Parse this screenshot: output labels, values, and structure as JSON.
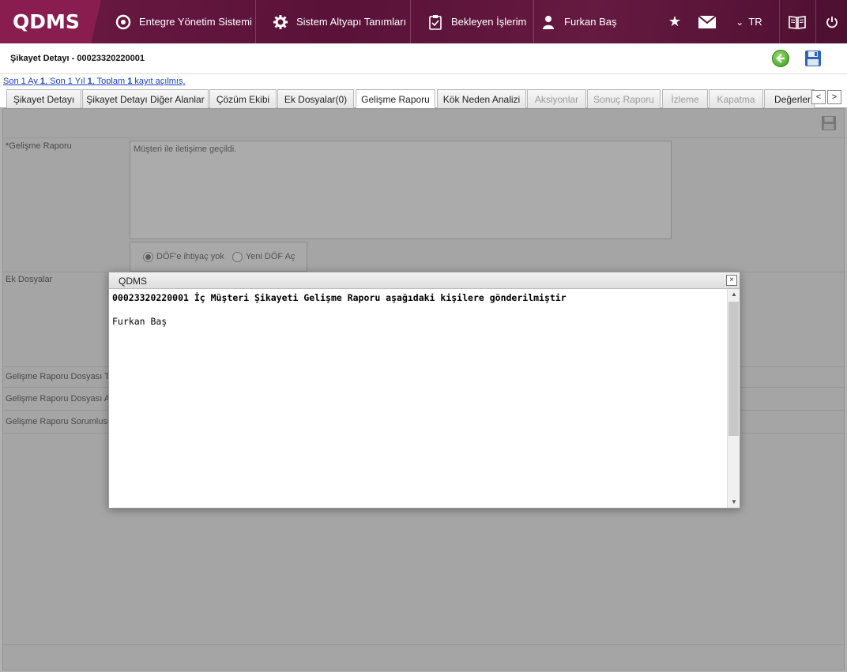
{
  "app": {
    "logo": "QDMS",
    "nav": [
      {
        "label": "Entegre Yönetim Sistemi",
        "icon": "qdms-circle-icon"
      },
      {
        "label": "Sistem Altyapı Tanımları",
        "icon": "gear-icon"
      },
      {
        "label": "Bekleyen İşlerim",
        "icon": "clipboard-icon"
      },
      {
        "label": "Furkan Baş",
        "icon": "user-icon"
      }
    ],
    "language": "TR"
  },
  "page": {
    "title": "Şikayet Detayı - 00023320220001",
    "record_info": {
      "prefix1": "Son 1 Ay ",
      "month_count": "1",
      "prefix2": ", Son 1 Yıl ",
      "year_count": "1",
      "prefix3": ", Toplam ",
      "total_count": "1",
      "suffix": " kayıt açılmış."
    }
  },
  "tabs": [
    {
      "label": "Şikayet Detayı",
      "state": "normal"
    },
    {
      "label": "Şikayet Detayı Diğer Alanlar",
      "state": "normal"
    },
    {
      "label": "Çözüm Ekibi",
      "state": "normal"
    },
    {
      "label": "Ek Dosyalar(0)",
      "state": "normal"
    },
    {
      "label": "Gelişme Raporu",
      "state": "active"
    },
    {
      "label": "Kök Neden Analizi",
      "state": "normal"
    },
    {
      "label": "Aksiyonlar",
      "state": "disabled"
    },
    {
      "label": "Sonuç Raporu",
      "state": "disabled"
    },
    {
      "label": "İzleme",
      "state": "disabled"
    },
    {
      "label": "Kapatma",
      "state": "disabled"
    },
    {
      "label": "Değerler",
      "state": "normal"
    }
  ],
  "form": {
    "gelisme_raporu_label": "*Gelişme Raporu",
    "gelisme_raporu_value": "Müşteri ile iletişime geçildi.",
    "dof_options": [
      {
        "label": "DÖF'e ihtiyaç yok",
        "checked": true
      },
      {
        "label": "Yeni DÖF Aç",
        "checked": false
      }
    ],
    "ek_dosyalar_label": "Ek Dosyalar",
    "dosya_turu_label": "Gelişme Raporu Dosyası Tü",
    "dosya_adi_label": "Gelişme Raporu Dosyası Ad",
    "sorumlu_label": "Gelişme Raporu Sorumlusu"
  },
  "dialog": {
    "title": "QDMS",
    "close": "×",
    "message": "00023320220001 İç Müşteri Şikayeti Gelişme Raporu aşağıdaki kişilere gönderilmiştir",
    "recipient": "Furkan Baş"
  },
  "colors": {
    "topbar": "#5a1238",
    "logo_bg": "#8a1d4f",
    "link": "#1a3fbf"
  }
}
